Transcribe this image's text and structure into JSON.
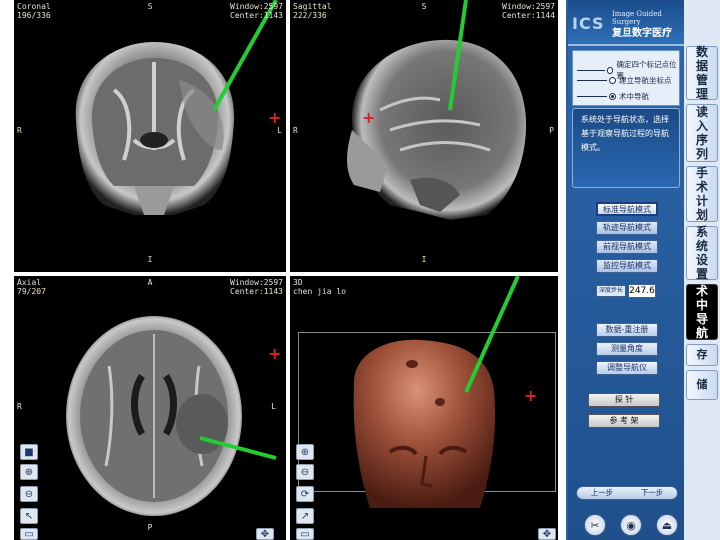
{
  "viewports": {
    "coronal": {
      "label": "Coronal",
      "slice": "196/336",
      "top_marker": "S",
      "window": "Window:2597",
      "center": "Center:1143",
      "left_marker": "R",
      "right_marker": "L",
      "bottom_marker": "I"
    },
    "sagittal": {
      "label": "Sagittal",
      "slice": "222/336",
      "top_marker": "S",
      "window": "Window:2597",
      "center": "Center:1144",
      "left_marker": "R",
      "right_marker": "P",
      "bottom_marker": "I"
    },
    "axial": {
      "label": "Axial",
      "slice": "79/207",
      "top_marker": "A",
      "window": "Window:2597",
      "center": "Center:1143",
      "left_marker": "R",
      "right_marker": "L",
      "bottom_marker": "P"
    },
    "view3d": {
      "label": "3D",
      "patient": "chen jia lo"
    }
  },
  "tool_icons": [
    "window-level-icon",
    "zoom-in-icon",
    "zoom-out-icon",
    "pointer-icon",
    "reset-icon"
  ],
  "panel": {
    "logo_abbr": "ICS",
    "logo_en": "Image Guided Surgery",
    "logo_zh": "复旦数字医疗",
    "steps": [
      {
        "label": "确定四个标记点位置",
        "selected": false
      },
      {
        "label": "建立导航坐标点",
        "selected": false
      },
      {
        "label": "术中导航",
        "selected": true
      }
    ],
    "message": "系统处于导航状态，选择基于观察导航过程的导航模式。",
    "modes": [
      "标准导航模式",
      "轨迹导航模式",
      "前视导航模式",
      "监控导航模式"
    ],
    "depth_label": "深度步长",
    "depth_value": "247.6",
    "actions": [
      "数据-重注册",
      "测量角度",
      "调整导航仪"
    ],
    "probe_buttons": [
      "探 针",
      "参 考 架"
    ],
    "pager": {
      "prev": "上一步",
      "next": "下一步"
    },
    "bottom_icons": [
      "tools-icon",
      "camera-icon",
      "exit-icon"
    ]
  },
  "side_tabs": [
    {
      "label": "数据管理",
      "active": false
    },
    {
      "label": "读入序列",
      "active": false
    },
    {
      "label": "手术计划",
      "active": false
    },
    {
      "label": "系统设置",
      "active": false
    },
    {
      "label": "术中导航",
      "active": true
    },
    {
      "label": "存",
      "active": false
    },
    {
      "label": "储",
      "active": false
    }
  ],
  "colors": {
    "overlay_text": "#e8e4c8",
    "probe_line": "#22cc33",
    "crosshair": "#e02020",
    "panel_blue": "#2a5f9e",
    "head_surface": "#a0523a"
  }
}
